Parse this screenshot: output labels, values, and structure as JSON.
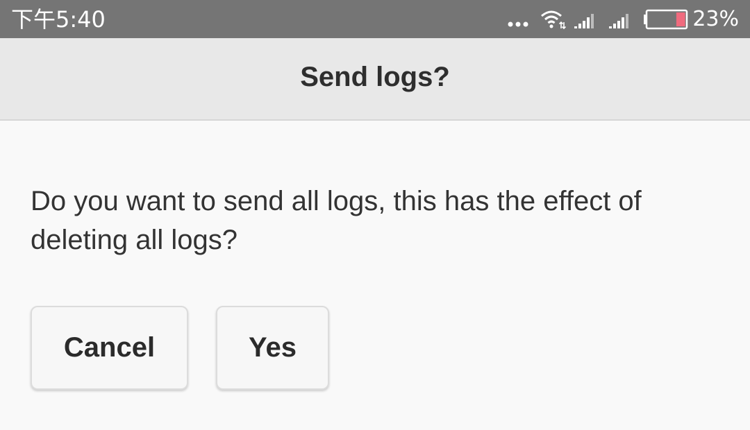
{
  "status_bar": {
    "time": "下午5:40",
    "battery_percent": "23%",
    "battery_level": 0.23,
    "battery_level_color": "#f06b7e",
    "icons": [
      "more-dots-icon",
      "wifi-icon",
      "signal-1-icon",
      "signal-2-icon",
      "battery-icon"
    ]
  },
  "dialog": {
    "title": "Send logs?",
    "message": "Do you want to send all logs, this has the effect of deleting all logs?",
    "cancel_label": "Cancel",
    "yes_label": "Yes"
  }
}
